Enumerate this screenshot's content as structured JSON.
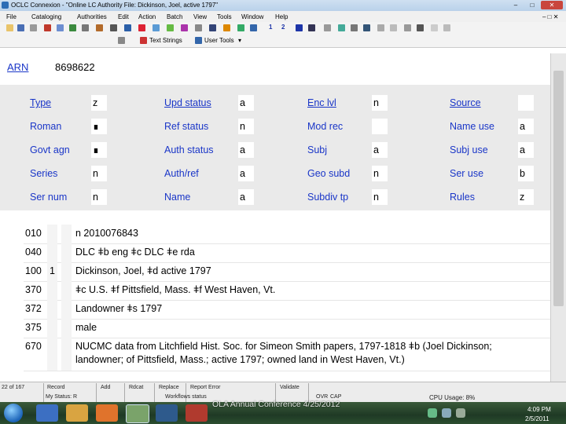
{
  "window": {
    "title": "OCLC Connexion - \"Online LC Authority File: Dickinson, Joel, active 1797\"",
    "min": "–",
    "max": "□",
    "close": "✕"
  },
  "menu": [
    "File",
    "Cataloging",
    "Authorities",
    "Edit",
    "Action",
    "Batch",
    "View",
    "Tools",
    "Window",
    "Help"
  ],
  "toolbar": {
    "num1": "1",
    "num2": "2",
    "text_strings": "Text Strings",
    "user_tools": "User Tools"
  },
  "record": {
    "arn_label": "ARN",
    "arn_value": "8698622",
    "fixed_fields": [
      [
        {
          "label": "Type",
          "value": "z",
          "link": true
        },
        {
          "label": "Upd status",
          "value": "a",
          "link": true
        },
        {
          "label": "Enc lvl",
          "value": "n",
          "link": true
        },
        {
          "label": "Source",
          "value": "",
          "link": true
        }
      ],
      [
        {
          "label": "Roman",
          "value": "∎",
          "link": false
        },
        {
          "label": "Ref status",
          "value": "n",
          "link": false
        },
        {
          "label": "Mod rec",
          "value": "",
          "link": false
        },
        {
          "label": "Name use",
          "value": "a",
          "link": false
        }
      ],
      [
        {
          "label": "Govt agn",
          "value": "∎",
          "link": false
        },
        {
          "label": "Auth status",
          "value": "a",
          "link": false
        },
        {
          "label": "Subj",
          "value": "a",
          "link": false
        },
        {
          "label": "Subj use",
          "value": "a",
          "link": false
        }
      ],
      [
        {
          "label": "Series",
          "value": "n",
          "link": false
        },
        {
          "label": "Auth/ref",
          "value": "a",
          "link": false
        },
        {
          "label": "Geo subd",
          "value": "n",
          "link": false
        },
        {
          "label": "Ser use",
          "value": "b",
          "link": false
        }
      ],
      [
        {
          "label": "Ser num",
          "value": "n",
          "link": false
        },
        {
          "label": "Name",
          "value": "a",
          "link": false
        },
        {
          "label": "Subdiv tp",
          "value": "n",
          "link": false
        },
        {
          "label": "Rules",
          "value": "z",
          "link": false
        }
      ]
    ],
    "var_fields": [
      {
        "tag": "010",
        "ind1": "",
        "data": [
          "n 2010076843"
        ]
      },
      {
        "tag": "040",
        "ind1": "",
        "data": [
          "DLC ǂb eng ǂc DLC ǂe rda"
        ]
      },
      {
        "tag": "100",
        "ind1": "1",
        "data": [
          "Dickinson, Joel, ǂd active 1797"
        ]
      },
      {
        "tag": "370",
        "ind1": "",
        "data": [
          "ǂc U.S. ǂf Pittsfield, Mass. ǂf West Haven, Vt."
        ]
      },
      {
        "tag": "372",
        "ind1": "",
        "data": [
          "Landowner ǂs 1797"
        ]
      },
      {
        "tag": "375",
        "ind1": "",
        "data": [
          "male"
        ]
      },
      {
        "tag": "670",
        "ind1": "",
        "data": [
          "NUCMC data from Litchfield Hist. Soc. for Simeon Smith papers, 1797-1818 ǂb (Joel Dickinson;",
          "landowner; of Pittsfield, Mass.; active 1797; owned land in West Haven, Vt.)"
        ]
      }
    ]
  },
  "statusbar": {
    "pos": "22 of 167",
    "record": "Record",
    "mystatus": "My Status: R",
    "add": "Add",
    "rdcat": "Rdcat",
    "replace": "Replace",
    "report_error": "Report Error",
    "workflow": "Workflows status",
    "validate": "Validate",
    "ovr": "OVR",
    "cap": "CAP",
    "cpu": "CPU Usage: 8%"
  },
  "footer_text": "OLA Annual Conference 4/25/2012",
  "taskbar": {
    "time": "4:09 PM",
    "date": "2/5/2011"
  }
}
